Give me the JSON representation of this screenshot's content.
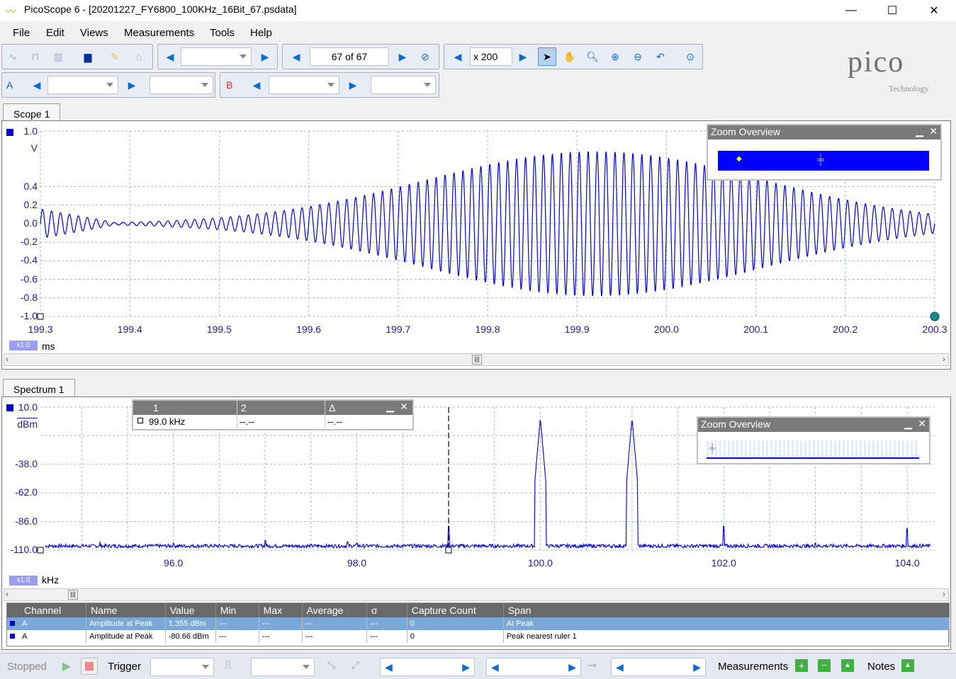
{
  "window": {
    "title": "PicoScope 6 - [20201227_FY6800_100KHz_16Bit_67.psdata]",
    "minimize": "—",
    "maximize": "☐",
    "close": "✕"
  },
  "menu": [
    {
      "label": "File"
    },
    {
      "label": "Edit"
    },
    {
      "label": "Views"
    },
    {
      "label": "Measurements"
    },
    {
      "label": "Tools"
    },
    {
      "label": "Help"
    }
  ],
  "toolbar": {
    "buffer": "67 of 67",
    "zoom": "x 200",
    "channel_a": "A",
    "channel_b": "B"
  },
  "logo": {
    "name": "pico",
    "sub": "Technology"
  },
  "scope": {
    "tab": "Scope 1",
    "y_top": "1.0",
    "y_unit": "V",
    "y_labels": [
      "0.4",
      "0.2",
      "0.0",
      "-0.2",
      "-0.4",
      "-0.6",
      "-0.8",
      "-1.0"
    ],
    "x_labels": [
      "199.3",
      "199.4",
      "199.5",
      "199.6",
      "199.7",
      "199.8",
      "199.9",
      "200.0",
      "200.1",
      "200.2",
      "200.3"
    ],
    "x_unit": "ms",
    "badge": "x1.0",
    "zoom_overview": "Zoom Overview"
  },
  "spectrum": {
    "tab": "Spectrum 1",
    "y_top": "10.0",
    "y_unit": "dBm",
    "y_labels": [
      "-38.0",
      "-62.0",
      "-86.0",
      "-110.0"
    ],
    "x_labels": [
      "96.0",
      "98.0",
      "100.0",
      "102.0",
      "104.0"
    ],
    "x_unit": "kHz",
    "badge": "x1.0",
    "zoom_overview": "Zoom Overview",
    "ruler": {
      "col1": "1",
      "col2": "2",
      "col3": "Δ",
      "val1": "99.0 kHz",
      "val2": "--.--",
      "val3": "--.--"
    }
  },
  "measurements": {
    "headers": [
      "Channel",
      "Name",
      "Value",
      "Min",
      "Max",
      "Average",
      "σ",
      "Capture Count",
      "Span"
    ],
    "rows": [
      [
        "A",
        "Amplitude at Peak",
        "1.355 dBm",
        "---",
        "---",
        "---",
        "---",
        "0",
        "At Peak"
      ],
      [
        "A",
        "Amplitude at Peak",
        "-80.66 dBm",
        "---",
        "---",
        "---",
        "---",
        "0",
        "Peak nearest ruler 1"
      ]
    ]
  },
  "statusbar": {
    "stopped": "Stopped",
    "trigger": "Trigger",
    "measurements": "Measurements",
    "notes": "Notes"
  },
  "colors": {
    "trace": "#0000e0",
    "grid": "#9ab8d8",
    "accent": "#0c6ad0"
  }
}
